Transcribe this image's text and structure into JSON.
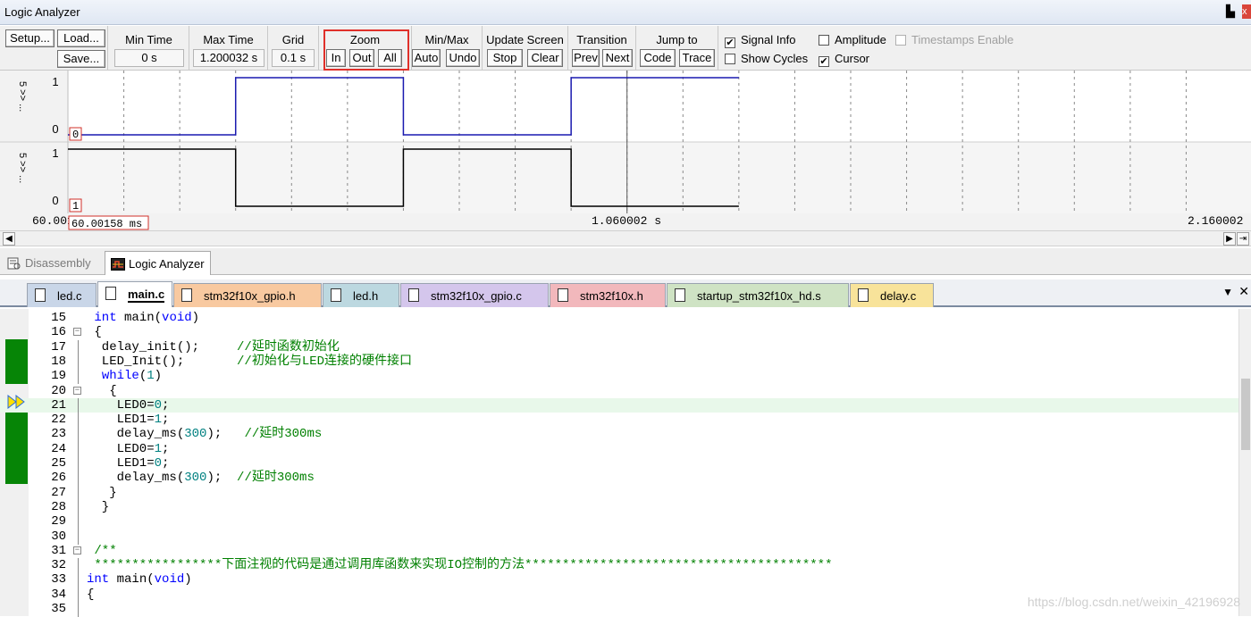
{
  "window": {
    "title": "Logic Analyzer",
    "pin_glyph": "▙",
    "close_glyph": "x"
  },
  "toolbar": {
    "setup": "Setup...",
    "load": "Load...",
    "save": "Save...",
    "min_time_label": "Min Time",
    "min_time_value": "0 s",
    "max_time_label": "Max Time",
    "max_time_value": "1.200032 s",
    "grid_label": "Grid",
    "grid_value": "0.1 s",
    "zoom_label": "Zoom",
    "zoom_in": "In",
    "zoom_out": "Out",
    "zoom_all": "All",
    "minmax_label": "Min/Max",
    "auto": "Auto",
    "undo": "Undo",
    "update_label": "Update Screen",
    "stop": "Stop",
    "clear": "Clear",
    "transition_label": "Transition",
    "prev": "Prev",
    "next": "Next",
    "jump_label": "Jump to",
    "code": "Code",
    "trace": "Trace",
    "signal_info": "Signal Info",
    "signal_info_checked": true,
    "show_cycles": "Show Cycles",
    "show_cycles_checked": false,
    "amplitude": "Amplitude",
    "amplitude_checked": false,
    "cursor": "Cursor",
    "cursor_checked": true,
    "timestamps": "Timestamps Enable",
    "timestamps_checked": false
  },
  "waveform": {
    "signals": [
      {
        "name": "5 >> ...",
        "marker": "0",
        "levels": [
          0,
          1,
          0,
          1
        ],
        "hi_label": "1",
        "lo_label": "0"
      },
      {
        "name": "5 >> ...",
        "marker": "1",
        "levels": [
          1,
          0,
          1,
          0
        ],
        "hi_label": "1",
        "lo_label": "0"
      }
    ],
    "edges_s": [
      0.3,
      0.6,
      0.9
    ],
    "data_end_s": 1.2,
    "view_start_s": 0,
    "view_end_s": 2.1,
    "signal_color_0": "#1a1ab0",
    "signal_color_1": "#000000",
    "time_left": "60.001",
    "time_cursor": "60.00158 ms",
    "time_mid": "1.060002 s",
    "time_right": "2.160002 s"
  },
  "window_tabs": [
    {
      "label": "Disassembly",
      "active": false
    },
    {
      "label": "Logic Analyzer",
      "active": true
    }
  ],
  "file_tabs": [
    {
      "label": "led.c",
      "color": "#c9d6e8",
      "active": false
    },
    {
      "label": "main.c",
      "color": "#ffffff",
      "active": true
    },
    {
      "label": "stm32f10x_gpio.h",
      "color": "#f8c9a0",
      "active": false
    },
    {
      "label": "led.h",
      "color": "#bcd8e0",
      "active": false
    },
    {
      "label": "stm32f10x_gpio.c",
      "color": "#d4c6ec",
      "active": false
    },
    {
      "label": "stm32f10x.h",
      "color": "#f2b8bc",
      "active": false
    },
    {
      "label": "startup_stm32f10x_hd.s",
      "color": "#cfe3c4",
      "active": false
    },
    {
      "label": "delay.c",
      "color": "#f8e39a",
      "active": false
    }
  ],
  "code": [
    {
      "n": "15",
      "text": " int main(void)"
    },
    {
      "n": "16",
      "text": " {"
    },
    {
      "n": "17",
      "text": "  delay_init();     //延时函数初始化"
    },
    {
      "n": "18",
      "text": "  LED_Init();       //初始化与LED连接的硬件接口"
    },
    {
      "n": "19",
      "text": "  while(1)"
    },
    {
      "n": "20",
      "text": "   {"
    },
    {
      "n": "21",
      "text": "    LED0=0;"
    },
    {
      "n": "22",
      "text": "    LED1=1;"
    },
    {
      "n": "23",
      "text": "    delay_ms(300);   //延时300ms"
    },
    {
      "n": "24",
      "text": "    LED0=1;"
    },
    {
      "n": "25",
      "text": "    LED1=0;"
    },
    {
      "n": "26",
      "text": "    delay_ms(300);  //延时300ms"
    },
    {
      "n": "27",
      "text": "   }"
    },
    {
      "n": "28",
      "text": "  }"
    },
    {
      "n": "29",
      "text": ""
    },
    {
      "n": "30",
      "text": ""
    },
    {
      "n": "31",
      "text": " /**"
    },
    {
      "n": "32",
      "text": " *****************下面注视的代码是通过调用库函数来实现IO控制的方法*****************************************"
    },
    {
      "n": "33",
      "text": "int main(void)"
    },
    {
      "n": "34",
      "text": "{"
    },
    {
      "n": "35",
      "text": ""
    }
  ],
  "watermark": "https://blog.csdn.net/weixin_42196928"
}
